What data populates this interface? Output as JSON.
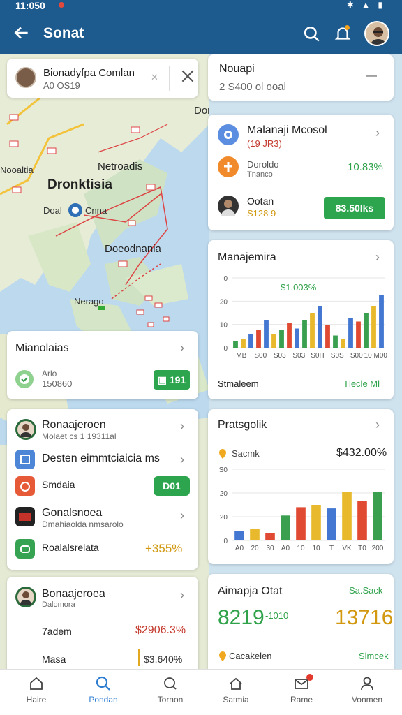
{
  "status_bar": {
    "time": "11:050"
  },
  "app_bar": {
    "title": "Sonat"
  },
  "map": {
    "search": {
      "title": "Bionadyfpa Comlan",
      "subtitle": "A0 OS19"
    },
    "labels": {
      "region": "Dorrkusia",
      "country": "Dronktisia",
      "city_n": "Netroadis",
      "city_pin_left": "Doal",
      "city_pin_right": "Cnna",
      "west": "Nooaltia",
      "south": "Doeodnania",
      "islands": "Nerago"
    }
  },
  "cards": {
    "top_right": {
      "title": "Nouapi",
      "subtitle": "2 S400 ol ooal"
    },
    "contacts": {
      "items": [
        {
          "name": "Malanaji Mcosol",
          "detail": "(19 JR3)",
          "icon": "bank-icon"
        },
        {
          "name": "Doroldo",
          "detail": "Tnanco",
          "value": "10.83%",
          "icon": "chart-icon"
        },
        {
          "name": "Ootan",
          "detail": "S128 9",
          "button": "83.50lks",
          "icon": "avatar"
        }
      ]
    },
    "management": {
      "title": "Manajemira",
      "annotation": "$1.003%",
      "footer_left": "Stmaleem",
      "footer_right": "Tlecle Ml"
    },
    "mianolaias": {
      "title": "Mianolaias",
      "sub1": "Arlo",
      "sub2": "150860",
      "button": "191"
    },
    "list_card": {
      "items": [
        {
          "title": "Ronaajeroen",
          "sub": "Molaet cs 1 19311al",
          "icon": "avatar"
        },
        {
          "title": "Desten eimmtciaicia ms",
          "icon": "calendar-icon"
        },
        {
          "title": "Smdaia",
          "button": "D01",
          "icon": "apple-icon"
        },
        {
          "title": "Gonalsnoea",
          "sub": "Dmahiaolda nmsarolo",
          "icon": "flag-icon"
        },
        {
          "title": "Roalalsrelata",
          "value": "+355%",
          "icon": "cloud-icon"
        }
      ]
    },
    "prats": {
      "title": "Pratsgolik",
      "sub": "Sacmk",
      "value": "$432.00%"
    },
    "bottom_left": {
      "title": "Bonaajeroea",
      "sub": "Dalomora",
      "row1_label": "7adem",
      "row1_value": "$2906.3%",
      "row2_label": "Masa",
      "row2_value": "$3.640%"
    },
    "bottom_right": {
      "title": "Aimapja Otat",
      "tag": "Sa.Sack",
      "big_left": "8219",
      "big_left_sup": "-1010",
      "big_right": "13716",
      "foot_left": "Cacakelen",
      "foot_right": "Slmcek"
    }
  },
  "chart_data": [
    {
      "type": "bar",
      "title": "Manajemira",
      "ylim": [
        0,
        40
      ],
      "y_ticks": [
        "0",
        "20",
        "10",
        "0"
      ],
      "categories": [
        "MB",
        "S00",
        "S03",
        "S03",
        "S0IT",
        "S0S",
        "S00",
        "10 M00"
      ],
      "colors": [
        "#3aa050",
        "#e8b92c",
        "#4477d1",
        "#e04a32",
        "#4477d1",
        "#e8b92c",
        "#3aa050",
        "#e04a32",
        "#4477d1",
        "#3aa050",
        "#e8b92c",
        "#4477d1",
        "#e04a32",
        "#3aa050",
        "#e8b92c",
        "#4477d1",
        "#e04a32",
        "#3aa050",
        "#e8b92c",
        "#4477d1"
      ],
      "values": [
        4,
        5,
        8,
        10,
        16,
        8,
        10,
        14,
        11,
        16,
        20,
        24,
        13,
        7,
        5,
        17,
        15,
        20,
        24,
        30
      ]
    },
    {
      "type": "bar",
      "title": "Pratsgolik",
      "y_ticks": [
        "S0",
        "20",
        "20",
        "0"
      ],
      "ylim": [
        0,
        60
      ],
      "categories": [
        "A0",
        "20",
        "30",
        "A0",
        "10",
        "10",
        "T",
        "VK",
        "T0",
        "200"
      ],
      "colors": [
        "#4477d1",
        "#e8b92c",
        "#e04a32",
        "#3aa050",
        "#e04a32",
        "#e8b92c",
        "#4477d1",
        "#e8b92c",
        "#e04a32",
        "#3aa050"
      ],
      "values": [
        8,
        10,
        6,
        21,
        28,
        30,
        27,
        41,
        33,
        41
      ]
    }
  ],
  "bottom_nav": [
    {
      "label": "Haire",
      "icon": "home-icon"
    },
    {
      "label": "Pondan",
      "icon": "search-icon"
    },
    {
      "label": "Tornon",
      "icon": "search-outline-icon"
    },
    {
      "label": "Satmia",
      "icon": "house-icon"
    },
    {
      "label": "Rame",
      "icon": "mail-icon"
    },
    {
      "label": "Vonmen",
      "icon": "person-icon"
    }
  ]
}
